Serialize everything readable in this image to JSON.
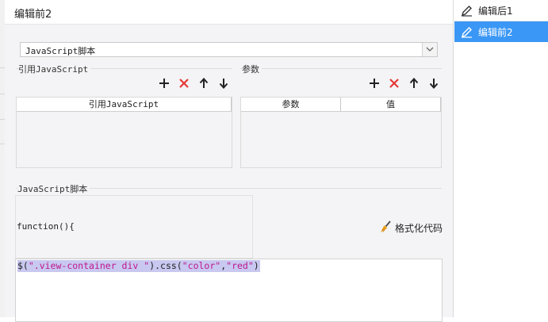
{
  "dialog": {
    "title": "编辑前2",
    "script_type_select": {
      "value": "JavaScript脚本"
    }
  },
  "ref_section": {
    "label": "引用JavaScript",
    "toolbar": {
      "add_icon": "plus-icon",
      "delete_icon": "red-x-icon",
      "up_icon": "arrow-up-icon",
      "down_icon": "arrow-down-icon"
    },
    "columns": [
      "引用JavaScript"
    ]
  },
  "param_section": {
    "label": "参数",
    "toolbar": {
      "add_icon": "plus-icon",
      "delete_icon": "red-x-icon",
      "up_icon": "arrow-up-icon",
      "down_icon": "arrow-down-icon"
    },
    "columns": [
      "参数",
      "值"
    ]
  },
  "script_section": {
    "label": "JavaScript脚本",
    "function_header": "function(){",
    "format_button": "格式化代码",
    "format_icon": "broom-icon",
    "code_tokens": [
      {
        "text": "$(",
        "kind": "default"
      },
      {
        "text": "\".view-container div \"",
        "kind": "string"
      },
      {
        "text": ").css(",
        "kind": "default"
      },
      {
        "text": "\"color\"",
        "kind": "string"
      },
      {
        "text": ",",
        "kind": "default"
      },
      {
        "text": "\"red\"",
        "kind": "string"
      },
      {
        "text": ")",
        "kind": "default"
      }
    ]
  },
  "side_list": {
    "items": [
      {
        "label": "编辑后1",
        "icon": "pencil-icon",
        "selected": false
      },
      {
        "label": "编辑前2",
        "icon": "pencil-icon",
        "selected": true
      }
    ]
  },
  "colors": {
    "accent": "#3b97f5",
    "delete": "#e53935",
    "string_token": "#c0168c",
    "selection": "#c8c8f0"
  }
}
